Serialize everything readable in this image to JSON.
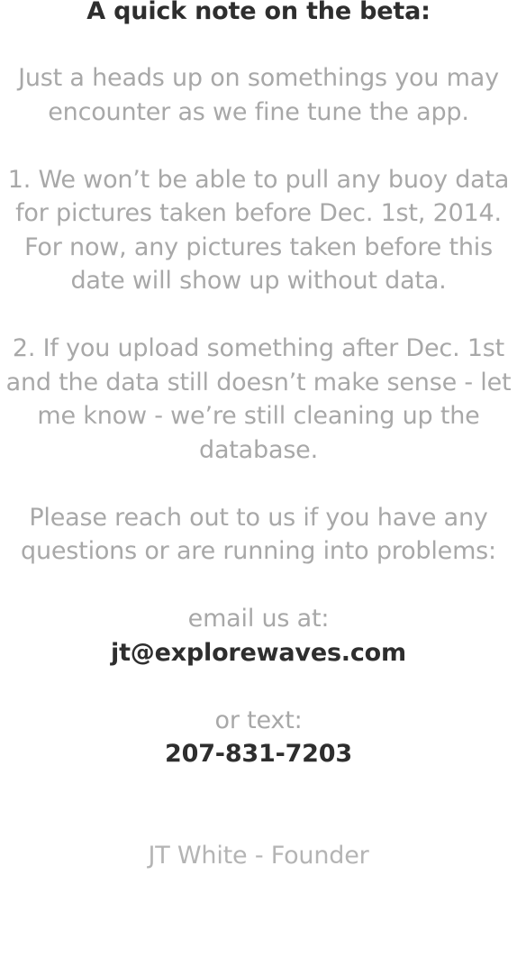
{
  "note": {
    "title": "A quick note on the beta:",
    "intro": [
      "Just a heads up on somethings you may",
      "encounter as we fine tune the app."
    ],
    "point1": [
      "1. We won’t be able to pull any buoy data",
      "for pictures taken before Dec. 1st, 2014.",
      "For now, any pictures taken before this",
      "date will show up without data."
    ],
    "point2": [
      "2. If you upload something after Dec. 1st",
      "and the data still doesn’t make sense - let",
      "me know - we’re still cleaning up the",
      "database."
    ],
    "reach_out": [
      "Please reach out to us if you have any",
      "questions or are running into problems:"
    ],
    "email_label": "email us at:",
    "email": "jt@explorewaves.com",
    "text_label": "or text:",
    "phone": "207-831-7203",
    "signature": "JT White - Founder"
  },
  "colors": {
    "body_text": "#a8a8a8",
    "dark_text": "#2e2e2e",
    "background": "#ffffff"
  }
}
